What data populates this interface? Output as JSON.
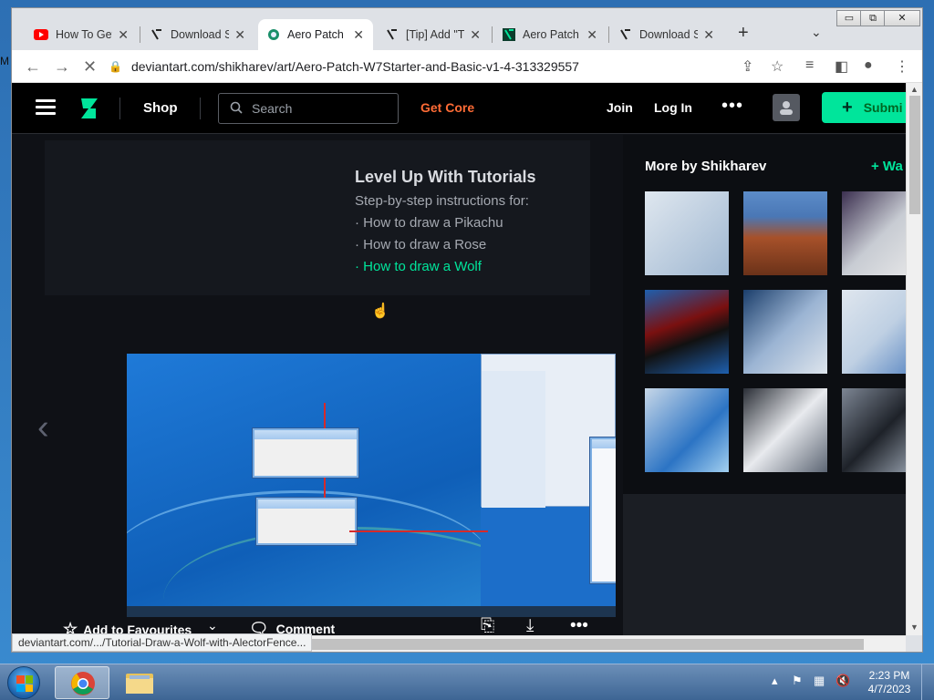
{
  "desktop": {
    "edge_text": "M"
  },
  "tabs": [
    {
      "label": "How To Get",
      "icon": "youtube-icon",
      "active": false
    },
    {
      "label": "Download S",
      "icon": "deviantart-icon",
      "active": false
    },
    {
      "label": "Aero Patch",
      "icon": "chrome-dev-icon",
      "active": true
    },
    {
      "label": "[Tip] Add \"T",
      "icon": "deviantart-icon",
      "active": false
    },
    {
      "label": "Aero Patch",
      "icon": "deviantart-green-icon",
      "active": false
    },
    {
      "label": "Download S",
      "icon": "deviantart-icon",
      "active": false
    }
  ],
  "window_controls": {
    "minimize": "▭",
    "restore": "⧉",
    "close": "✕"
  },
  "address": {
    "url": "deviantart.com/shikharev/art/Aero-Patch-W7Starter-and-Basic-v1-4-313329557"
  },
  "site": {
    "shop": "Shop",
    "search_placeholder": "Search",
    "get_core": "Get Core",
    "join": "Join",
    "login": "Log In",
    "submit": "Submi"
  },
  "ad": {
    "title": "Level Up With Tutorials",
    "subtitle": "Step-by-step instructions for:",
    "items": [
      "· How to draw a Pikachu",
      "· How to draw a Rose",
      "· How to draw a Wolf"
    ]
  },
  "actions": {
    "add_fav": "Add to Favourites",
    "comment": "Comment"
  },
  "sidebar": {
    "title": "More by Shikharev",
    "watch": "+ Wa"
  },
  "status_bar": "deviantart.com/.../Tutorial-Draw-a-Wolf-with-AlectorFence...",
  "taskbar": {
    "time": "2:23 PM",
    "date": "4/7/2023"
  },
  "colors": {
    "accent": "#00e59b",
    "get_core": "#ff6c36",
    "page_bg": "#0f1116"
  }
}
